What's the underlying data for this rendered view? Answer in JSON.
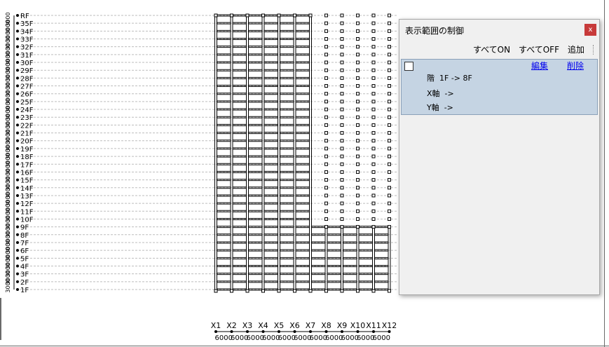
{
  "structure": {
    "floors": [
      "1F",
      "2F",
      "3F",
      "4F",
      "5F",
      "6F",
      "7F",
      "8F",
      "9F",
      "10F",
      "11F",
      "12F",
      "13F",
      "14F",
      "15F",
      "16F",
      "17F",
      "18F",
      "19F",
      "20F",
      "21F",
      "22F",
      "23F",
      "24F",
      "25F",
      "26F",
      "27F",
      "28F",
      "29F",
      "30F",
      "31F",
      "32F",
      "33F",
      "34F",
      "35F",
      "RF"
    ],
    "story_height_label": "3000",
    "axes": [
      "X1",
      "X2",
      "X3",
      "X4",
      "X5",
      "X6",
      "X7",
      "X8",
      "X9",
      "X10",
      "X11",
      "X12"
    ],
    "spans": [
      "6000",
      "6000",
      "6000",
      "6000",
      "6000",
      "6000",
      "6000",
      "6000",
      "6000",
      "6000",
      "6000"
    ],
    "tall_axes_count": 7,
    "low_block_top_floor": "9F",
    "colors": {
      "frame": "#000000",
      "guide": "#bdbdbd",
      "node": "#000000"
    }
  },
  "dialog": {
    "title": "表示範囲の制御",
    "close_label": "x",
    "toolbar": {
      "all_on": "すべてON",
      "all_off": "すべてOFF",
      "add": "追加"
    },
    "range_item": {
      "checked": false,
      "edit_label": "編集",
      "delete_label": "削除",
      "floor_row": "階  1F -> 8F",
      "x_row": "X軸  ->",
      "y_row": "Y軸  ->"
    }
  }
}
